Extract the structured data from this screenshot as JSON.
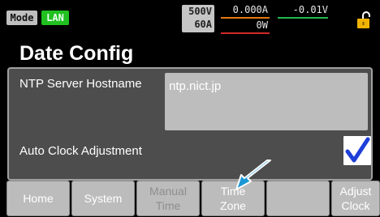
{
  "status": {
    "mode_label": "Mode",
    "lan_label": "LAN",
    "voltage_rating": "500V",
    "current_rating": "60A",
    "current_readout": "0.000A",
    "voltage_readout": "-0.01V",
    "power_readout": "0W",
    "colors": {
      "lan": "#20c020",
      "current": "#e07a10",
      "voltage": "#22b84a",
      "power": "#d02828",
      "lock": "#f0b400"
    }
  },
  "page": {
    "title": "Date Config"
  },
  "form": {
    "ntp_label": "NTP Server Hostname",
    "ntp_value": "ntp.nict.jp",
    "auto_clock_label": "Auto Clock Adjustment",
    "auto_clock_checked": true
  },
  "buttons": {
    "home": "Home",
    "system": "System",
    "manual_time_1": "Manual",
    "manual_time_2": "Time",
    "time_zone_1": "Time",
    "time_zone_2": "Zone",
    "adjust_clock_1": "Adjust",
    "adjust_clock_2": "Clock"
  }
}
